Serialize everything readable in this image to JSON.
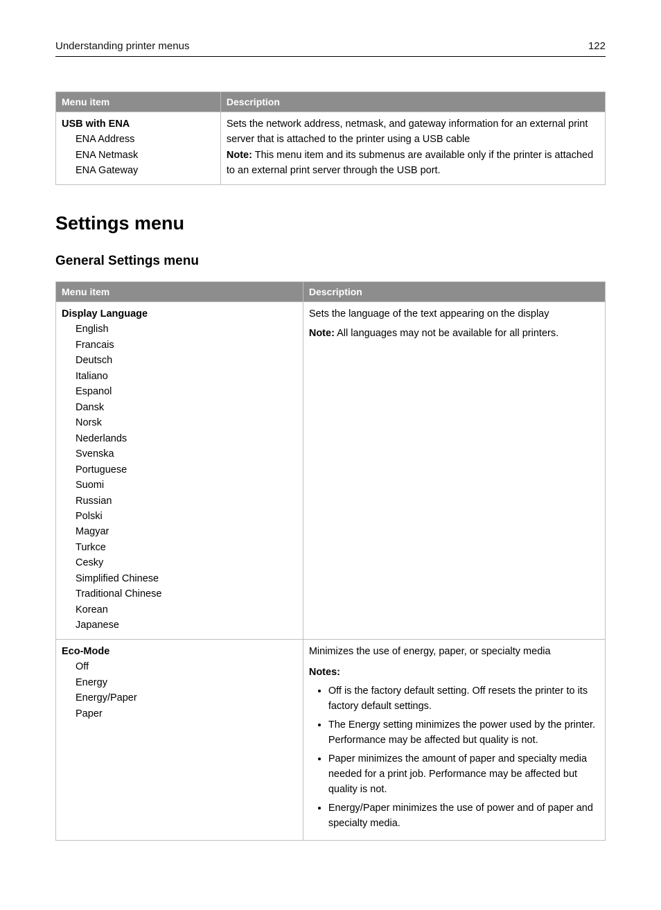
{
  "header": {
    "section": "Understanding printer menus",
    "page_no": "122"
  },
  "table1": {
    "cols": {
      "menu": "Menu item",
      "desc": "Description"
    },
    "row": {
      "title": "USB with ENA",
      "subs": [
        "ENA Address",
        "ENA Netmask",
        "ENA Gateway"
      ],
      "desc_p1": "Sets the network address, netmask, and gateway information for an external print server that is attached to the printer using a USB cable",
      "note_label": "Note:",
      "note_text": " This menu item and its submenus are available only if the printer is attached to an external print server through the USB port."
    }
  },
  "h1": "Settings menu",
  "h2": "General Settings menu",
  "table2": {
    "cols": {
      "menu": "Menu item",
      "desc": "Description"
    },
    "row1": {
      "title": "Display Language",
      "subs": [
        "English",
        "Francais",
        "Deutsch",
        "Italiano",
        "Espanol",
        "Dansk",
        "Norsk",
        "Nederlands",
        "Svenska",
        "Portuguese",
        "Suomi",
        "Russian",
        "Polski",
        "Magyar",
        "Turkce",
        "Cesky",
        "Simplified Chinese",
        "Traditional Chinese",
        "Korean",
        "Japanese"
      ],
      "desc_p1": "Sets the language of the text appearing on the display",
      "note_label": "Note:",
      "note_text": " All languages may not be available for all printers."
    },
    "row2": {
      "title": "Eco-Mode",
      "subs": [
        "Off",
        "Energy",
        "Energy/Paper",
        "Paper"
      ],
      "desc_p1": "Minimizes the use of energy, paper, or specialty media",
      "notes_label": "Notes:",
      "bullets": [
        "Off is the factory default setting. Off resets the printer to its factory default settings.",
        "The Energy setting minimizes the power used by the printer. Performance may be affected but quality is not.",
        "Paper minimizes the amount of paper and specialty media needed for a print job. Performance may be affected but quality is not.",
        "Energy/Paper minimizes the use of power and of paper and specialty media."
      ]
    }
  }
}
